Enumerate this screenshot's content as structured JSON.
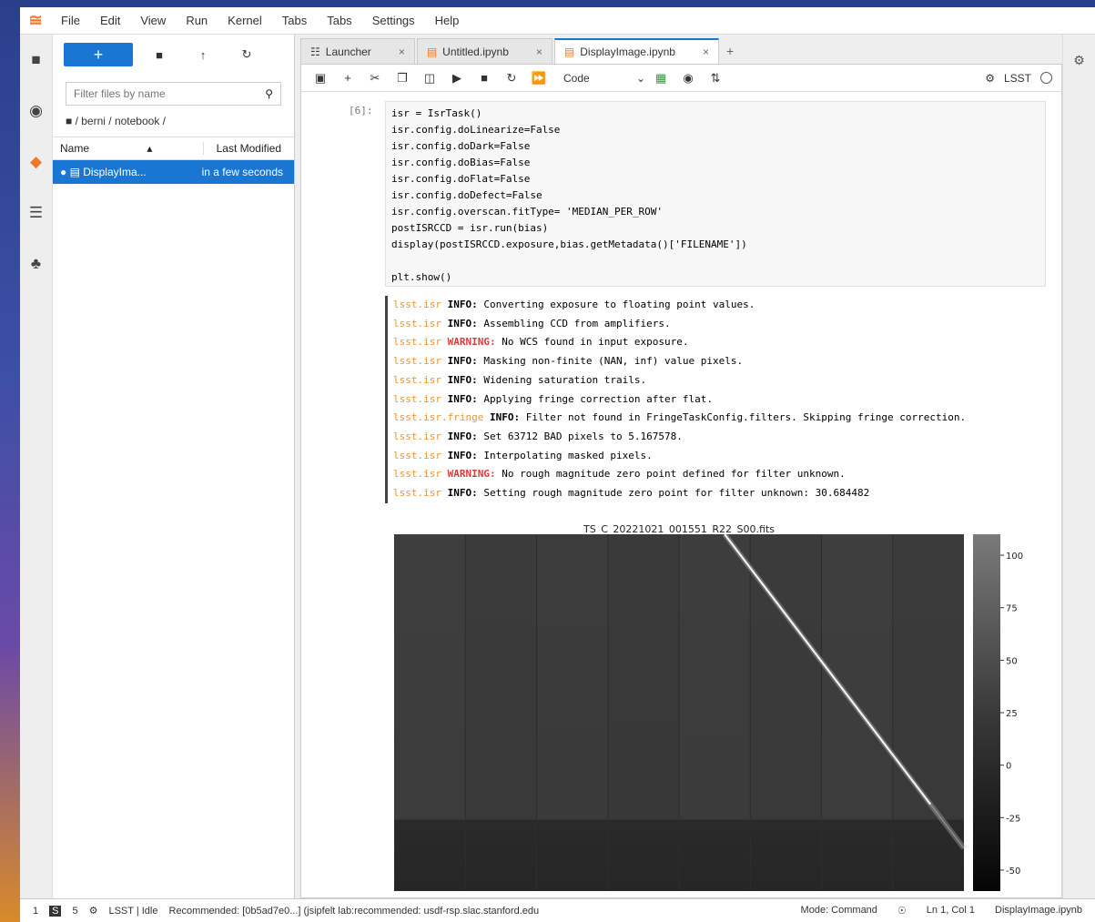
{
  "menubar": {
    "items": [
      "File",
      "Edit",
      "View",
      "Run",
      "Kernel",
      "Tabs",
      "Tabs",
      "Settings",
      "Help"
    ]
  },
  "left_rail": {
    "icons": [
      "folder-icon",
      "running-icon",
      "git-icon",
      "toc-icon",
      "extension-icon"
    ]
  },
  "filebrowser": {
    "new_label": "+",
    "filter_placeholder": "Filter files by name",
    "path": "/ berni / notebook /",
    "col_name": "Name",
    "col_modified": "Last Modified",
    "files": [
      {
        "name": "DisplayIma...",
        "modified": "in a few seconds"
      }
    ]
  },
  "tabs": [
    {
      "label": "Launcher"
    },
    {
      "label": "Untitled.ipynb"
    },
    {
      "label": "DisplayImage.ipynb"
    }
  ],
  "notebook_toolbar": {
    "cell_type": "Code",
    "kernel_name": "LSST"
  },
  "code_cell": {
    "prompt": "[6]:",
    "lines": [
      "isr = IsrTask()",
      "isr.config.doLinearize=False",
      "isr.config.doDark=False",
      "isr.config.doBias=False",
      "isr.config.doFlat=False",
      "isr.config.doDefect=False",
      "isr.config.overscan.fitType= 'MEDIAN_PER_ROW'",
      "postISRCCD = isr.run(bias)",
      "display(postISRCCD.exposure,bias.getMetadata()['FILENAME'])",
      "",
      "plt.show()"
    ]
  },
  "output_log": [
    {
      "src": "lsst.isr",
      "level": "INFO",
      "msg": "Converting exposure to floating point values."
    },
    {
      "src": "lsst.isr",
      "level": "INFO",
      "msg": "Assembling CCD from amplifiers."
    },
    {
      "src": "lsst.isr",
      "level": "WARNING",
      "msg": "No WCS found in input exposure."
    },
    {
      "src": "lsst.isr",
      "level": "INFO",
      "msg": "Masking non-finite (NAN, inf) value pixels."
    },
    {
      "src": "lsst.isr",
      "level": "INFO",
      "msg": "Widening saturation trails."
    },
    {
      "src": "lsst.isr",
      "level": "INFO",
      "msg": "Applying fringe correction after flat."
    },
    {
      "src": "lsst.isr.fringe",
      "level": "INFO",
      "msg": "Filter not found in FringeTaskConfig.filters. Skipping fringe correction."
    },
    {
      "src": "lsst.isr",
      "level": "INFO",
      "msg": "Set 63712 BAD pixels to 5.167578."
    },
    {
      "src": "lsst.isr",
      "level": "INFO",
      "msg": "Interpolating masked pixels."
    },
    {
      "src": "lsst.isr",
      "level": "WARNING",
      "msg": "No rough magnitude zero point defined for filter unknown."
    },
    {
      "src": "lsst.isr",
      "level": "INFO",
      "msg": "Setting rough magnitude zero point for filter unknown: 30.684482"
    }
  ],
  "chart_data": {
    "type": "heatmap",
    "title": "TS_C_20221021_001551_R22_S00.fits",
    "colorbar_ticks": [
      "100",
      "75",
      "50",
      "25",
      "0",
      "-25",
      "-50"
    ],
    "colorbar_range": [
      -60,
      110
    ],
    "amp_columns": 8,
    "streak": {
      "from": [
        0.58,
        0.0
      ],
      "to": [
        1.0,
        0.88
      ]
    }
  },
  "statusbar": {
    "num1": "1",
    "num2": "5",
    "kernel_status": "LSST | Idle",
    "recommended": "Recommended: [0b5ad7e0...] (jsipfelt lab:recommended: usdf-rsp.slac.stanford.edu",
    "mode": "Mode: Command",
    "position": "Ln 1, Col 1",
    "filename": "DisplayImage.ipynb"
  },
  "colors": {
    "accent": "#1976d2",
    "jupyter_orange": "#f37726"
  }
}
